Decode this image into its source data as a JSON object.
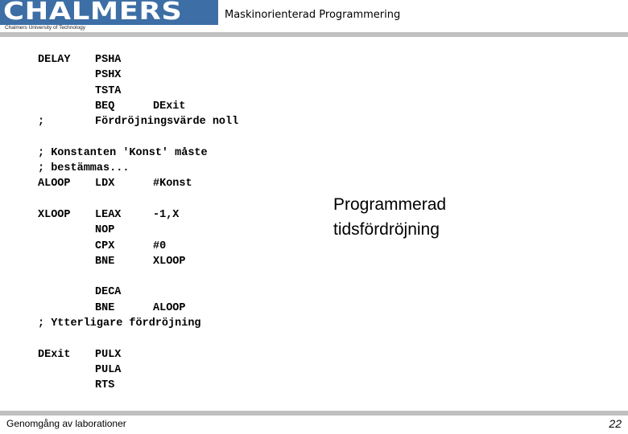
{
  "header": {
    "logo_text": "CHALMERS",
    "logo_subtitle": "Chalmers University of Technology",
    "course_title": "Maskinorienterad Programmering",
    "brand_color": "#3d6ea5",
    "bar_color": "#c0c0c0"
  },
  "code": {
    "lines": [
      {
        "label": "DELAY",
        "op": "PSHA",
        "arg": ""
      },
      {
        "label": "",
        "op": "PSHX",
        "arg": ""
      },
      {
        "label": "",
        "op": "TSTA",
        "arg": ""
      },
      {
        "label": "",
        "op": "BEQ",
        "arg": "DExit"
      },
      {
        "label": ";",
        "op": "Fördröjningsvärde noll",
        "arg": ""
      },
      {
        "comment": ""
      },
      {
        "comment": "; Konstanten 'Konst' måste"
      },
      {
        "comment": "; bestämmas..."
      },
      {
        "label": "ALOOP",
        "op": "LDX",
        "arg": "#Konst"
      },
      {
        "comment": ""
      },
      {
        "label": "XLOOP",
        "op": "LEAX",
        "arg": "-1,X"
      },
      {
        "label": "",
        "op": "NOP",
        "arg": ""
      },
      {
        "label": "",
        "op": "CPX",
        "arg": "#0"
      },
      {
        "label": "",
        "op": "BNE",
        "arg": "XLOOP"
      },
      {
        "comment": ""
      },
      {
        "label": "",
        "op": "DECA",
        "arg": ""
      },
      {
        "label": "",
        "op": "BNE",
        "arg": "ALOOP"
      },
      {
        "comment": "; Ytterligare fördröjning"
      },
      {
        "comment": ""
      },
      {
        "label": "DExit",
        "op": "PULX",
        "arg": ""
      },
      {
        "label": "",
        "op": "PULA",
        "arg": ""
      },
      {
        "label": "",
        "op": "RTS",
        "arg": ""
      }
    ]
  },
  "side_note": {
    "line1": "Programmerad",
    "line2": "tidsfördröjning"
  },
  "footer": {
    "left_text": "Genomgång av laborationer",
    "page_number": "22"
  }
}
